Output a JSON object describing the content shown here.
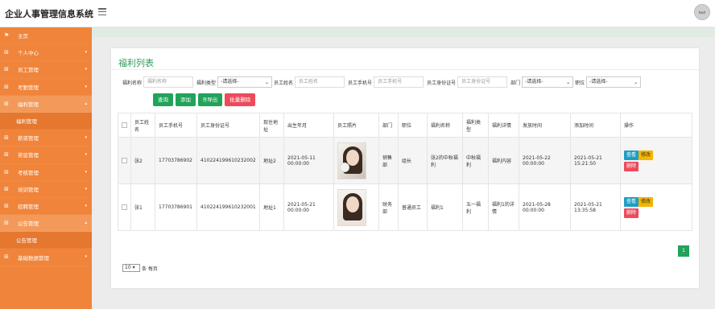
{
  "app": {
    "title": "企业人事管理信息系统",
    "avatar_label": "tout"
  },
  "sidebar": {
    "items": [
      {
        "label": "主页",
        "icon": "flag-icon",
        "caret": ""
      },
      {
        "label": "个人中心",
        "icon": "grid-icon",
        "caret": "▾"
      },
      {
        "label": "员工管理",
        "icon": "grid-icon",
        "caret": "▾"
      },
      {
        "label": "考勤管理",
        "icon": "grid-icon",
        "caret": "▾"
      },
      {
        "label": "福利管理",
        "icon": "grid-icon",
        "caret": "▴"
      },
      {
        "label": "福利管理",
        "icon": "",
        "caret": ""
      },
      {
        "label": "薪资管理",
        "icon": "grid-icon",
        "caret": "▾"
      },
      {
        "label": "奖惩管理",
        "icon": "grid-icon",
        "caret": "▾"
      },
      {
        "label": "考核管理",
        "icon": "grid-icon",
        "caret": "▾"
      },
      {
        "label": "培训管理",
        "icon": "grid-icon",
        "caret": "▾"
      },
      {
        "label": "招聘管理",
        "icon": "grid-icon",
        "caret": "▾"
      },
      {
        "label": "公告管理",
        "icon": "grid-icon",
        "caret": "▴"
      },
      {
        "label": "公告管理",
        "icon": "",
        "caret": ""
      },
      {
        "label": "基础数据管理",
        "icon": "grid-icon",
        "caret": "▾"
      }
    ]
  },
  "panel": {
    "title": "福利列表"
  },
  "filters": {
    "welfare_name_label": "福利名称",
    "welfare_name_placeholder": "福利名称",
    "welfare_type_label": "福利类型",
    "welfare_type_value": "-请选择-",
    "employee_name_label": "员工姓名",
    "employee_name_placeholder": "员工姓名",
    "employee_phone_label": "员工手机号",
    "employee_phone_placeholder": "员工手机号",
    "employee_id_label": "员工身份证号",
    "employee_id_placeholder": "员工身份证号",
    "department_label": "部门",
    "department_value": "-请选择-",
    "position_label": "职位",
    "position_value": "-请选择-"
  },
  "buttons": {
    "search": "查询",
    "add": "添加",
    "export": "导出",
    "batch_delete": "批量删除"
  },
  "table": {
    "headers": [
      "员工姓名",
      "员工手机号",
      "员工身份证号",
      "现住地址",
      "出生年月",
      "员工照片",
      "部门",
      "职位",
      "福利名称",
      "福利类型",
      "福利详情",
      "发放时间",
      "添加时间",
      "操作"
    ],
    "rows": [
      {
        "name": "张2",
        "phone": "17703786902",
        "id_card": "410224199610232002",
        "address": "地址2",
        "birth": "2021-05-11 00:00:00",
        "dept": "销售部",
        "position": "组长",
        "welfare_name": "张2的中秋福利",
        "welfare_type": "中秋福利",
        "detail": "福利内容",
        "issue_time": "2021-05-22 00:00:00",
        "add_time": "2021-05-21 15:21:50"
      },
      {
        "name": "张1",
        "phone": "17703786901",
        "id_card": "410224199610232001",
        "address": "地址1",
        "birth": "2021-05-21 00:00:00",
        "dept": "财务部",
        "position": "普通员工",
        "welfare_name": "福利1",
        "welfare_type": "五一福利",
        "detail": "福利1的详情",
        "issue_time": "2021-05-28 00:00:00",
        "add_time": "2021-05-21 13:35:58"
      }
    ],
    "actions": {
      "view": "查看",
      "edit": "修改",
      "delete": "删除"
    }
  },
  "pager": {
    "page_size": "10",
    "page_size_suffix": "条 每页",
    "current_page": "1"
  }
}
